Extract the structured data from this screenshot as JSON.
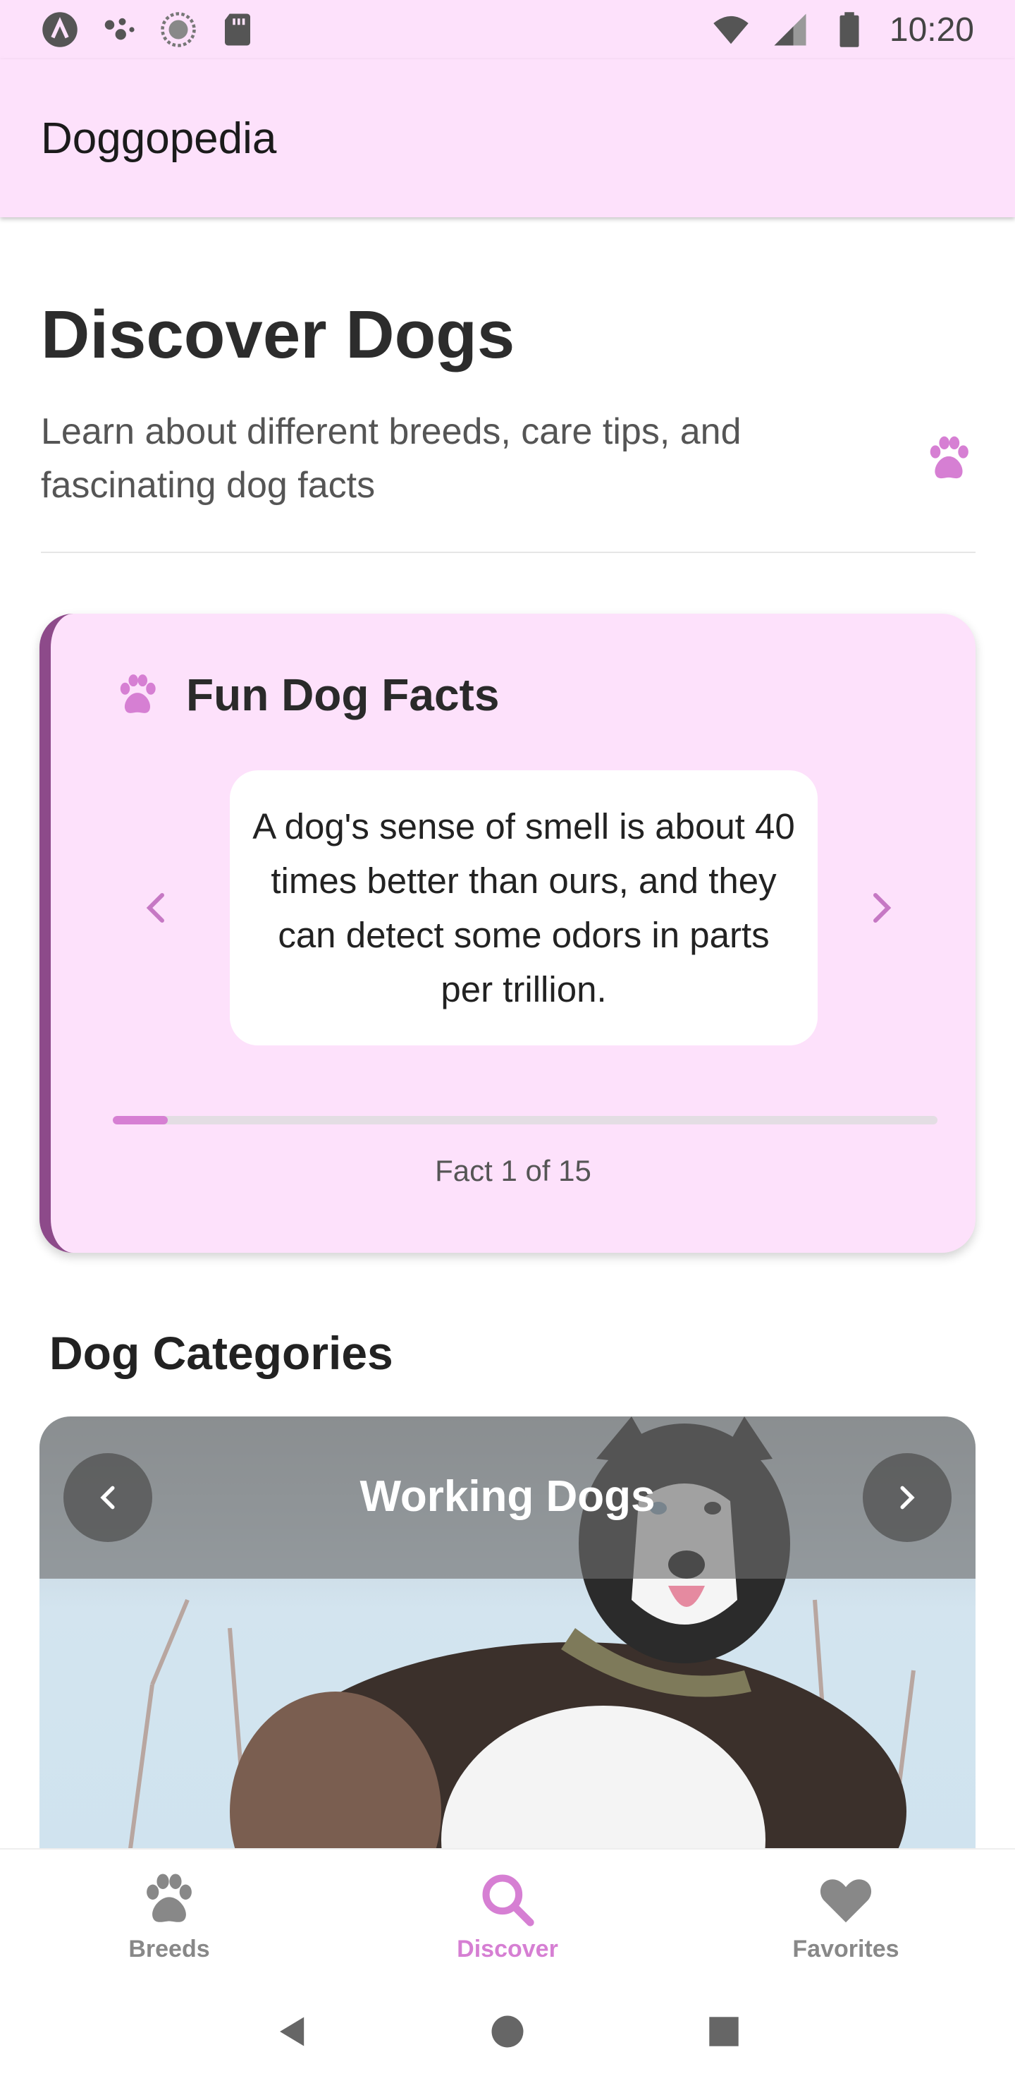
{
  "status_bar": {
    "time": "10:20",
    "left_icons": [
      "app-a-icon",
      "assistant-dots-icon",
      "sync-circle-icon",
      "sd-card-icon"
    ],
    "right_icons": [
      "wifi-icon",
      "cellular-signal-icon",
      "battery-icon"
    ]
  },
  "app_bar": {
    "title": "Doggopedia"
  },
  "header": {
    "title": "Discover Dogs",
    "subtitle": "Learn about different breeds, care tips, and fascinating dog facts"
  },
  "facts_card": {
    "title": "Fun Dog Facts",
    "fact_text": "A dog's sense of smell is about 40 times better than ours, and they can detect some odors in parts per trillion.",
    "counter": "Fact 1 of 15",
    "progress_fraction": 0.0667
  },
  "categories": {
    "section_title": "Dog Categories",
    "current_title": "Working Dogs"
  },
  "bottom_nav": {
    "items": [
      {
        "label": "Breeds",
        "icon": "paw-icon",
        "active": false
      },
      {
        "label": "Discover",
        "icon": "search-icon",
        "active": true
      },
      {
        "label": "Favorites",
        "icon": "heart-icon",
        "active": false
      }
    ]
  },
  "colors": {
    "header_bg": "#fde1fb",
    "accent": "#d67fd3",
    "card_border": "#8d4a8a",
    "inactive_nav": "#888888"
  }
}
